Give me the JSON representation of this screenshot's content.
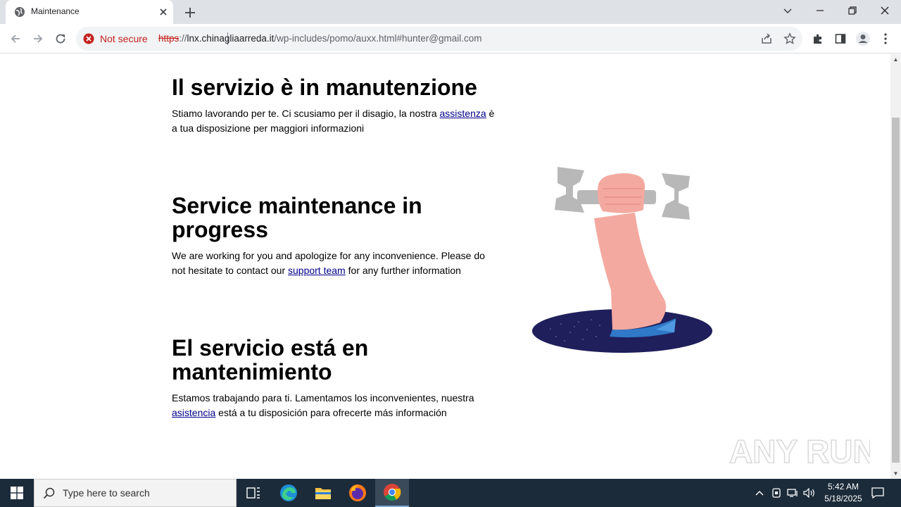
{
  "browser": {
    "tab_title": "Maintenance",
    "security_label": "Not secure",
    "url_scheme": "https",
    "url_sep": "://",
    "url_host": "lnx.chinagliaarreda.it",
    "url_path": "/wp-includes/pomo/auxx.html#hunter@gmail.com"
  },
  "page": {
    "italian": {
      "heading": "Il servizio è in manutenzione",
      "text_before": "Stiamo lavorando per te. Ci scusiamo per il disagio, la nostra ",
      "link": "assistenza",
      "text_after": " è a tua disposizione per maggiori informazioni"
    },
    "english": {
      "heading": "Service maintenance in progress",
      "text_before": "We are working for you and apologize for any inconvenience. Please do not hesitate to contact our ",
      "link": "support team",
      "text_after": " for any further information"
    },
    "spanish": {
      "heading": "El servicio está en mantenimiento",
      "text_before": "Estamos trabajando para ti. Lamentamos los inconvenientes, nuestra ",
      "link": "asistencia",
      "text_after": " está a tu disposición para ofrecerte más información"
    },
    "watermark": "ANY RUN"
  },
  "taskbar": {
    "search_placeholder": "Type here to search",
    "time": "5:42 AM",
    "date": "5/18/2025",
    "apps": [
      "task-view",
      "edge",
      "file-explorer",
      "firefox",
      "chrome"
    ]
  }
}
